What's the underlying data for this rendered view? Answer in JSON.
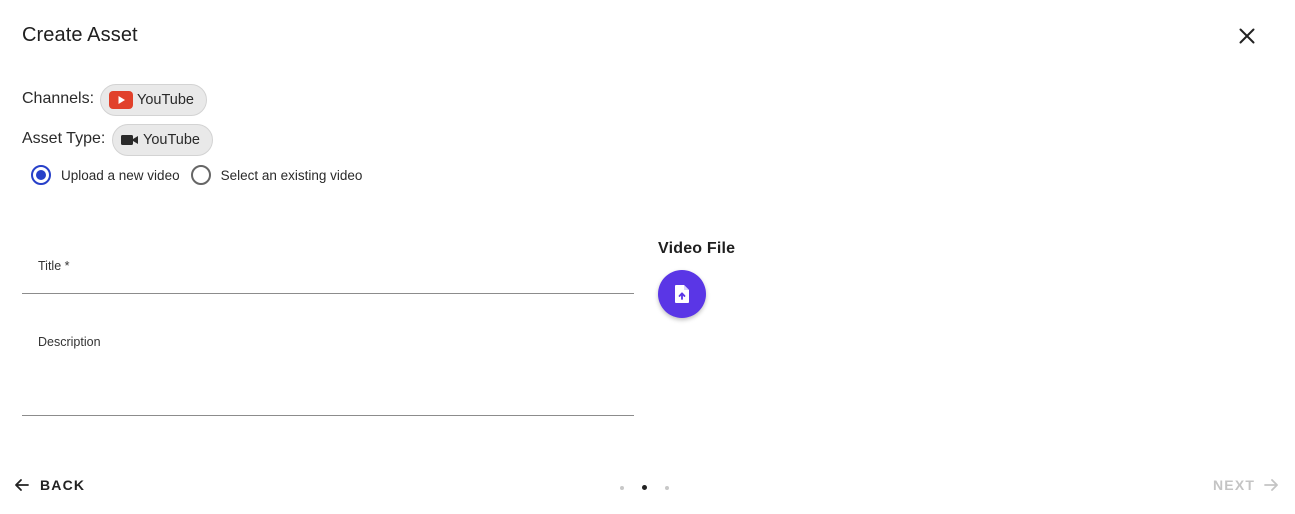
{
  "dialog": {
    "title": "Create Asset",
    "close_icon": "close-icon"
  },
  "channels": {
    "label": "Channels:",
    "chip_label": "YouTube",
    "chip_icon": "youtube-logo-icon",
    "chip_icon_color": "#e1412b"
  },
  "asset_type": {
    "label": "Asset Type:",
    "chip_label": "YouTube",
    "chip_icon": "video-camera-icon"
  },
  "upload_options": {
    "selected": "upload-new",
    "options": [
      {
        "id": "upload-new",
        "label": "Upload a new video"
      },
      {
        "id": "select-existing",
        "label": "Select an existing video"
      }
    ]
  },
  "form": {
    "title_label": "Title *",
    "title_value": "",
    "description_label": "Description",
    "description_value": ""
  },
  "video_file": {
    "heading": "Video File",
    "upload_icon": "file-upload-icon"
  },
  "footer": {
    "back_label": "BACK",
    "back_icon": "arrow-left-icon",
    "next_label": "NEXT",
    "next_icon": "arrow-right-icon",
    "next_disabled": true,
    "step_count": 3,
    "current_step": 2
  },
  "colors": {
    "accent": "#5a36e6",
    "radio_selected": "#2740c9",
    "youtube_red": "#e1412b"
  }
}
